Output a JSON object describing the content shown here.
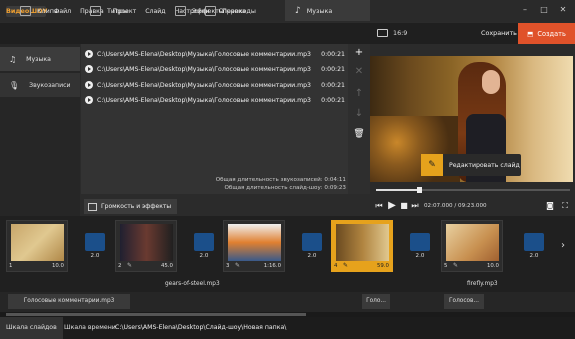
{
  "app": {
    "logo": "ВидеоШОУ"
  },
  "menu": [
    "Файл",
    "Правка",
    "Проект",
    "Слайд",
    "Настройки",
    "Справка"
  ],
  "tabs": [
    "Клипы",
    "Титры",
    "Эффекты",
    "Переходы",
    "Музыка"
  ],
  "ratio": "16:9",
  "save_label": "Сохранить",
  "create_label": "Создать",
  "sidebar": [
    "Музыка",
    "Звукозаписи"
  ],
  "files": [
    {
      "name": "C:\\Users\\AMS-Elena\\Desktop\\Музыка\\Голосовые комментарии.mp3",
      "time": "0:00:21"
    },
    {
      "name": "C:\\Users\\AMS-Elena\\Desktop\\Музыка\\Голосовые комментарии.mp3",
      "time": "0:00:21"
    },
    {
      "name": "C:\\Users\\AMS-Elena\\Desktop\\Музыка\\Голосовые комментарии.mp3",
      "time": "0:00:21"
    },
    {
      "name": "C:\\Users\\AMS-Elena\\Desktop\\Музыка\\Голосовые комментарии.mp3",
      "time": "0:00:21"
    }
  ],
  "total_voice": "Общая длительность звукозаписей: 0:04:11",
  "total_slideshow": "Общая длительность слайд-шоу: 0:09:23",
  "effects_btn": "Громкость и эффекты",
  "edit_tip": "Редактировать слайд",
  "timecode": "02:07.000 / 09:23.000",
  "playback_progress": 0.22,
  "slides": [
    {
      "num": "1",
      "dur": "10.0"
    },
    {
      "num": "2",
      "dur": "45.0"
    },
    {
      "num": "3",
      "dur": "1:16.0"
    },
    {
      "num": "4",
      "dur": "59.0"
    },
    {
      "num": "5",
      "dur": "10.0"
    }
  ],
  "transitions": [
    "2.0",
    "2.0",
    "2.0",
    "2.0",
    "2.0"
  ],
  "track_labels": [
    "gears-of-steel.mp3",
    "firefly.mp3"
  ],
  "audio_clips": [
    "Голосовые комментарии.mp3",
    "Голо...",
    "Голосов..."
  ],
  "bottom_tabs": [
    "Шкала слайдов",
    "Шкала времени"
  ],
  "path": "C:\\Users\\AMS-Elena\\Desktop\\Слайд-шоу\\Новая папка\\"
}
